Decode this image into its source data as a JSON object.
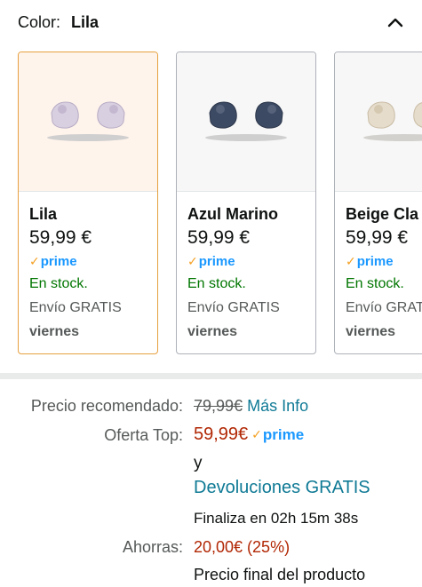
{
  "color": {
    "label": "Color:",
    "selected": "Lila"
  },
  "icons": {
    "collapse": "chevron-up-icon",
    "prime_check": "check-icon"
  },
  "variants": [
    {
      "name": "Lila",
      "price": "59,99 €",
      "prime": "prime",
      "stock": "En stock.",
      "shipping": "Envío GRATIS",
      "day": "viernes",
      "selected": true,
      "bud_color": "#d8cfe0"
    },
    {
      "name": "Azul Marino",
      "price": "59,99 €",
      "prime": "prime",
      "stock": "En stock.",
      "shipping": "Envío GRATIS",
      "day": "viernes",
      "selected": false,
      "bud_color": "#3c4a63"
    },
    {
      "name": "Beige Cla",
      "price": "59,99 €",
      "prime": "prime",
      "stock": "En stock.",
      "shipping": "Envío GRAT",
      "day": "viernes",
      "selected": false,
      "bud_color": "#e6dccb"
    }
  ],
  "pricing": {
    "recommended_label": "Precio recomendado:",
    "recommended_price": "79,99€",
    "more_info": "Más Info",
    "offer_label": "Oferta Top:",
    "offer_price": "59,99€",
    "prime": "prime",
    "and": "y",
    "returns": "Devoluciones GRATIS",
    "countdown": "Finaliza en 02h 15m 38s",
    "savings_label": "Ahorras:",
    "savings_value": "20,00€ (25%)",
    "final_price": "Precio final del producto"
  },
  "colors": {
    "accent_link": "#0f7a95",
    "prime_blue": "#1a98ff",
    "stock_green": "#007600",
    "price_red": "#b12704",
    "selected_border": "#e7a140"
  }
}
